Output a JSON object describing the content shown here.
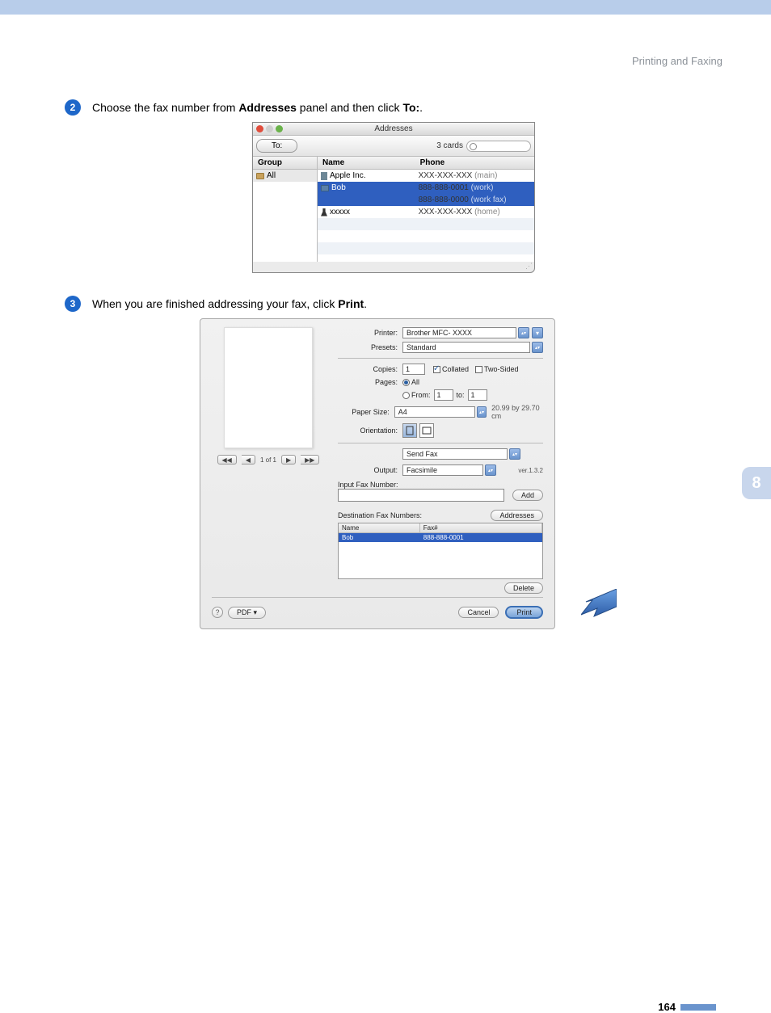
{
  "header": {
    "section_title": "Printing and Faxing"
  },
  "chapter": {
    "number": "8"
  },
  "page_number": "164",
  "step2": {
    "num": "2",
    "text_pre": "Choose the fax number from ",
    "bold1": "Addresses",
    "text_mid": " panel and then click ",
    "bold2": "To:",
    "text_post": "."
  },
  "step3": {
    "num": "3",
    "text_pre": "When you are finished addressing your fax, click ",
    "bold1": "Print",
    "text_post": "."
  },
  "addresses": {
    "title": "Addresses",
    "tab_to": "To:",
    "card_count": "3 cards",
    "group_header": "Group",
    "group_all": "All",
    "name_header": "Name",
    "phone_header": "Phone",
    "rows": [
      {
        "name": "Apple Inc.",
        "phone": "XXX-XXX-XXX",
        "phone_sub": "(main)"
      },
      {
        "name": "Bob",
        "phone": "888-888-0001",
        "phone_sub": "(work)"
      },
      {
        "name": "",
        "phone": "888-888-0000",
        "phone_sub": "(work fax)"
      },
      {
        "name": "xxxxx",
        "phone": "XXX-XXX-XXX",
        "phone_sub": "(home)"
      }
    ]
  },
  "print": {
    "printer_label": "Printer:",
    "printer_value": "Brother MFC- XXXX",
    "presets_label": "Presets:",
    "presets_value": "Standard",
    "copies_label": "Copies:",
    "copies_value": "1",
    "collated": "Collated",
    "twosided": "Two-Sided",
    "pages_label": "Pages:",
    "pages_all": "All",
    "pages_from": "From:",
    "pages_from_v": "1",
    "pages_to": "to:",
    "pages_to_v": "1",
    "papersize_label": "Paper Size:",
    "papersize_value": "A4",
    "papersize_dim": "20.99 by 29.70 cm",
    "orientation_label": "Orientation:",
    "panel_select": "Send Fax",
    "output_label": "Output:",
    "output_value": "Facsimile",
    "version": "ver.1.3.2",
    "input_fax_label": "Input Fax Number:",
    "add": "Add",
    "dest_label": "Destination Fax Numbers:",
    "addresses_btn": "Addresses",
    "tbl_name": "Name",
    "tbl_fax": "Fax#",
    "row_name": "Bob",
    "row_fax": "888-888-0001",
    "delete": "Delete",
    "preview_nav": "1 of 1",
    "pdf": "PDF ▾",
    "cancel": "Cancel",
    "print": "Print"
  }
}
